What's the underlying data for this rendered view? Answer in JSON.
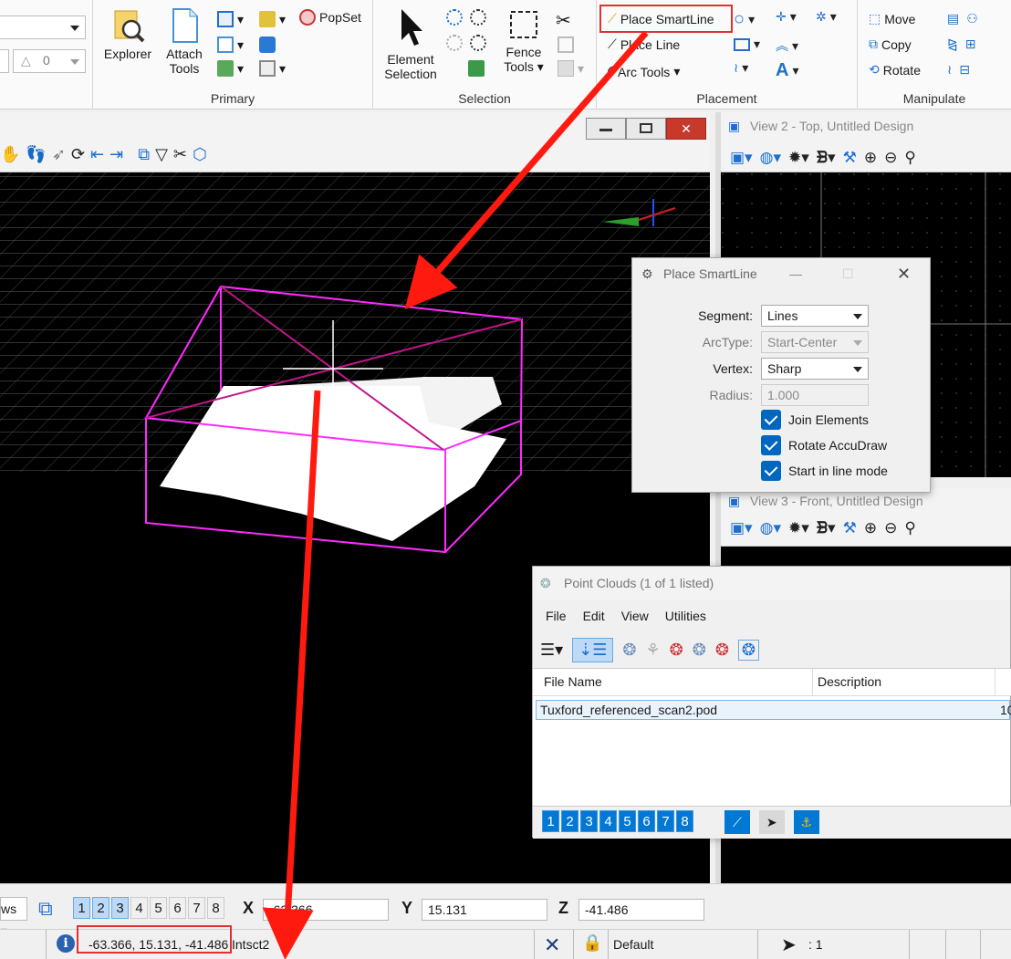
{
  "ribbon": {
    "combo_value": "0",
    "primary": {
      "explorer": "Explorer",
      "attach_tools_1": "Attach",
      "attach_tools_2": "Tools",
      "popset": "PopSet",
      "label": "Primary"
    },
    "selection": {
      "element_1": "Element",
      "element_2": "Selection",
      "fence_1": "Fence",
      "fence_2": "Tools",
      "label": "Selection"
    },
    "placement": {
      "smartline": "Place SmartLine",
      "line": "Place Line",
      "arc": "Arc Tools",
      "label": "Placement"
    },
    "manipulate": {
      "move": "Move",
      "copy": "Copy",
      "rotate": "Rotate",
      "label": "Manipulate"
    }
  },
  "views": {
    "view2_title": "View 2 - Top, Untitled Design",
    "view3_title": "View 3 - Front, Untitled Design"
  },
  "smartline_dialog": {
    "title": "Place SmartLine",
    "segment_label": "Segment:",
    "segment_value": "Lines",
    "arctype_label": "ArcType:",
    "arctype_value": "Start-Center",
    "vertex_label": "Vertex:",
    "vertex_value": "Sharp",
    "radius_label": "Radius:",
    "radius_value": "1.000",
    "join": "Join Elements",
    "rotate": "Rotate AccuDraw",
    "start": "Start in line mode"
  },
  "point_clouds": {
    "title": "Point Clouds (1 of 1 listed)",
    "menu": [
      "File",
      "Edit",
      "View",
      "Utilities"
    ],
    "col_file": "File Name",
    "col_desc": "Description",
    "row_file": "Tuxford_referenced_scan2.pod",
    "row_extra": "10",
    "view_nums": [
      "1",
      "2",
      "3",
      "4",
      "5",
      "6",
      "7",
      "8"
    ]
  },
  "bottom": {
    "views_label": "ws",
    "view_nums": [
      "1",
      "2",
      "3",
      "4",
      "5",
      "6",
      "7",
      "8"
    ],
    "x_label": "X",
    "x_value": "-63.366",
    "y_label": "Y",
    "y_value": "15.131",
    "z_label": "Z",
    "z_value": "-41.486"
  },
  "status": {
    "coords": "-63.366, 15.131, -41.486",
    "snap": "Intsct2",
    "level": "Default",
    "selcount": ": 1"
  },
  "colors": {
    "accent": "#0078d4",
    "bounding_box": "#ff2bff",
    "annotation_red": "#ff1a10"
  }
}
